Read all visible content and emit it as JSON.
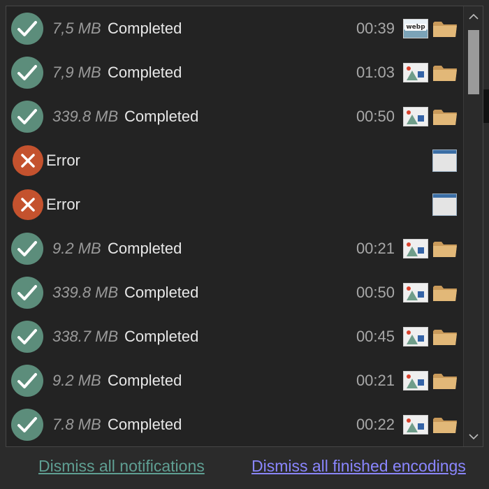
{
  "notifications": [
    {
      "status": "ok",
      "size": "7,5 MB",
      "label": "Completed",
      "time": "00:39",
      "thumb": "webp"
    },
    {
      "status": "ok",
      "size": "7,9 MB",
      "label": "Completed",
      "time": "01:03",
      "thumb": "image"
    },
    {
      "status": "ok",
      "size": "339.8 MB",
      "label": "Completed",
      "time": "00:50",
      "thumb": "image"
    },
    {
      "status": "error",
      "label": "Error"
    },
    {
      "status": "error",
      "label": "Error"
    },
    {
      "status": "ok",
      "size": "9.2 MB",
      "label": "Completed",
      "time": "00:21",
      "thumb": "image"
    },
    {
      "status": "ok",
      "size": "339.8 MB",
      "label": "Completed",
      "time": "00:50",
      "thumb": "image"
    },
    {
      "status": "ok",
      "size": "338.7 MB",
      "label": "Completed",
      "time": "00:45",
      "thumb": "image"
    },
    {
      "status": "ok",
      "size": "9.2 MB",
      "label": "Completed",
      "time": "00:21",
      "thumb": "image"
    },
    {
      "status": "ok",
      "size": "7.8 MB",
      "label": "Completed",
      "time": "00:22",
      "thumb": "image"
    }
  ],
  "thumb_webp_text": "webp",
  "footer": {
    "dismiss_all": "Dismiss all notifications",
    "dismiss_finished": "Dismiss all finished encodings"
  },
  "colors": {
    "ok": "#5c8d7b",
    "error": "#c4522e",
    "link1": "#5f9f93",
    "link2": "#8a86ff"
  }
}
